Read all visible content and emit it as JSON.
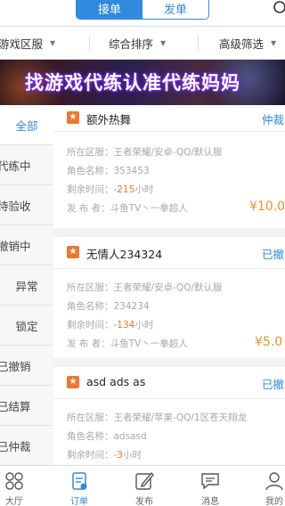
{
  "header": {
    "tabs": [
      {
        "label": "接单",
        "active": true
      },
      {
        "label": "发单",
        "active": false
      }
    ]
  },
  "filters": [
    {
      "label": "游戏区服"
    },
    {
      "label": "综合排序"
    },
    {
      "label": "高级筛选"
    }
  ],
  "banner": {
    "text": "找游戏代练认准代练妈妈"
  },
  "sidebar": {
    "items": [
      {
        "label": "全部",
        "active": true
      },
      {
        "label": "代练中"
      },
      {
        "label": "待验收"
      },
      {
        "label": "撤销中"
      },
      {
        "label": "异常"
      },
      {
        "label": "锁定"
      },
      {
        "label": "已撤销"
      },
      {
        "label": "已结算"
      },
      {
        "label": "已仲裁"
      }
    ]
  },
  "orders": [
    {
      "title": "额外热舞",
      "status": "仲裁",
      "server_label": "所在区服：",
      "server": "王者荣耀/安卓-QQ/默认服",
      "role_label": "角色名称：",
      "role": "353453",
      "time_label": "剩余时间：",
      "time": "-215",
      "time_unit": "小时",
      "publisher_label": "发 布 者：",
      "publisher": "斗鱼TV丶一拳超人",
      "price": "¥10.0"
    },
    {
      "title": "无情人234324",
      "status": "已撤",
      "server_label": "所在区服：",
      "server": "王者荣耀/安卓-QQ/默认服",
      "role_label": "角色名称：",
      "role": "234234",
      "time_label": "剩余时间：",
      "time": "-134",
      "time_unit": "小时",
      "publisher_label": "发 布 者：",
      "publisher": "斗鱼TV丶一拳超人",
      "price": "¥5.0"
    },
    {
      "title": "asd ads as",
      "status": "已撤",
      "server_label": "所在区服：",
      "server": "王者荣耀/苹果-QQ/1区苍天翔龙",
      "role_label": "角色名称：",
      "role": "adsasd",
      "time_label": "剩余时间：",
      "time": "-3",
      "time_unit": "小时"
    }
  ],
  "tabbar": [
    {
      "label": "大厅",
      "icon": "grid-icon"
    },
    {
      "label": "订单",
      "icon": "order-icon",
      "active": true
    },
    {
      "label": "发布",
      "icon": "edit-icon"
    },
    {
      "label": "消息",
      "icon": "message-icon"
    },
    {
      "label": "我的",
      "icon": "user-icon"
    }
  ],
  "colors": {
    "accent": "#2f8ae0",
    "orange": "#f0762e",
    "price": "#e8942a"
  }
}
